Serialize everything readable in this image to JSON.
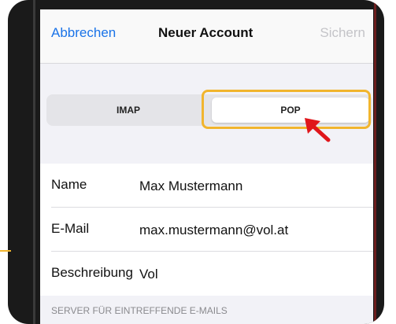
{
  "navbar": {
    "cancel_label": "Abbrechen",
    "title": "Neuer Account",
    "save_label": "Sichern"
  },
  "account_type": {
    "options": [
      "IMAP",
      "POP"
    ],
    "selected": "POP"
  },
  "form": {
    "name": {
      "label": "Name",
      "value": "Max Mustermann"
    },
    "email": {
      "label": "E-Mail",
      "value": "max.mustermann@vol.at"
    },
    "description": {
      "label": "Beschreibung",
      "value": "Vol"
    }
  },
  "incoming_section_header": "SERVER FÜR EINTREFFENDE E-MAILS",
  "colors": {
    "accent_blue": "#1a73e8",
    "highlight_outline": "#f1b52e",
    "annotation_arrow": "#e0161b"
  },
  "icons": {
    "annotation": "pointer-arrow-icon"
  }
}
